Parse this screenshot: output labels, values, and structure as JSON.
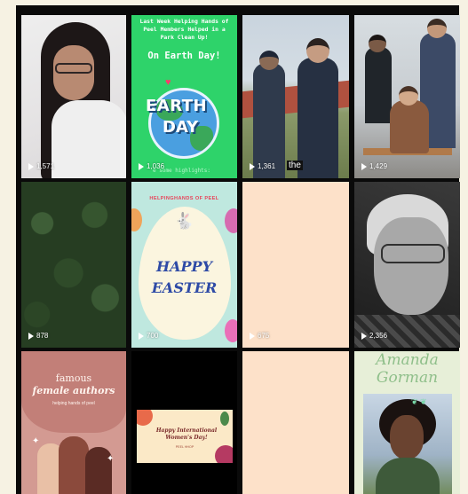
{
  "grid": {
    "tiles": [
      {
        "id": "selfie",
        "views": "1,571"
      },
      {
        "id": "earth-day",
        "views": "1,036",
        "headline": "Last Week Helping Hands of Peel Members Helped in a Park Clean Up!",
        "subheadline": "On Earth Day!",
        "logo_word1": "EARTH",
        "logo_word2": "DAY",
        "caption": "e some highlights:"
      },
      {
        "id": "boys-track",
        "views": "1,361",
        "caption": "the"
      },
      {
        "id": "group-stairs",
        "views": "1,429"
      },
      {
        "id": "forest",
        "views": "878"
      },
      {
        "id": "easter",
        "views": "700",
        "brand": "HELPINGHANDS OF PEEL",
        "line1": "HAPPY",
        "line2": "EASTER"
      },
      {
        "id": "blank-1",
        "views": "675"
      },
      {
        "id": "elder-portrait",
        "views": "2,356"
      },
      {
        "id": "authors",
        "line1": "famous",
        "line2": "female authors",
        "line3": "helping hands of peel"
      },
      {
        "id": "womens-day",
        "line1": "Happy International",
        "line2": "Women's Day!",
        "sub": "PEEL HHOP"
      },
      {
        "id": "blank-2"
      },
      {
        "id": "amanda",
        "name1": "Amanda",
        "name2": "Gorman"
      }
    ]
  },
  "colors": {
    "background": "#f6f2e3",
    "frame": "#0a0a0a",
    "earth_day_green": "#2ed36a",
    "peach": "#fde1c9",
    "easter_blue": "#2e4aa6"
  },
  "icons": {
    "views": "play-icon",
    "bunny": "bunny-icon",
    "heart": "heart-icon",
    "sparkle": "sparkle-icon"
  }
}
